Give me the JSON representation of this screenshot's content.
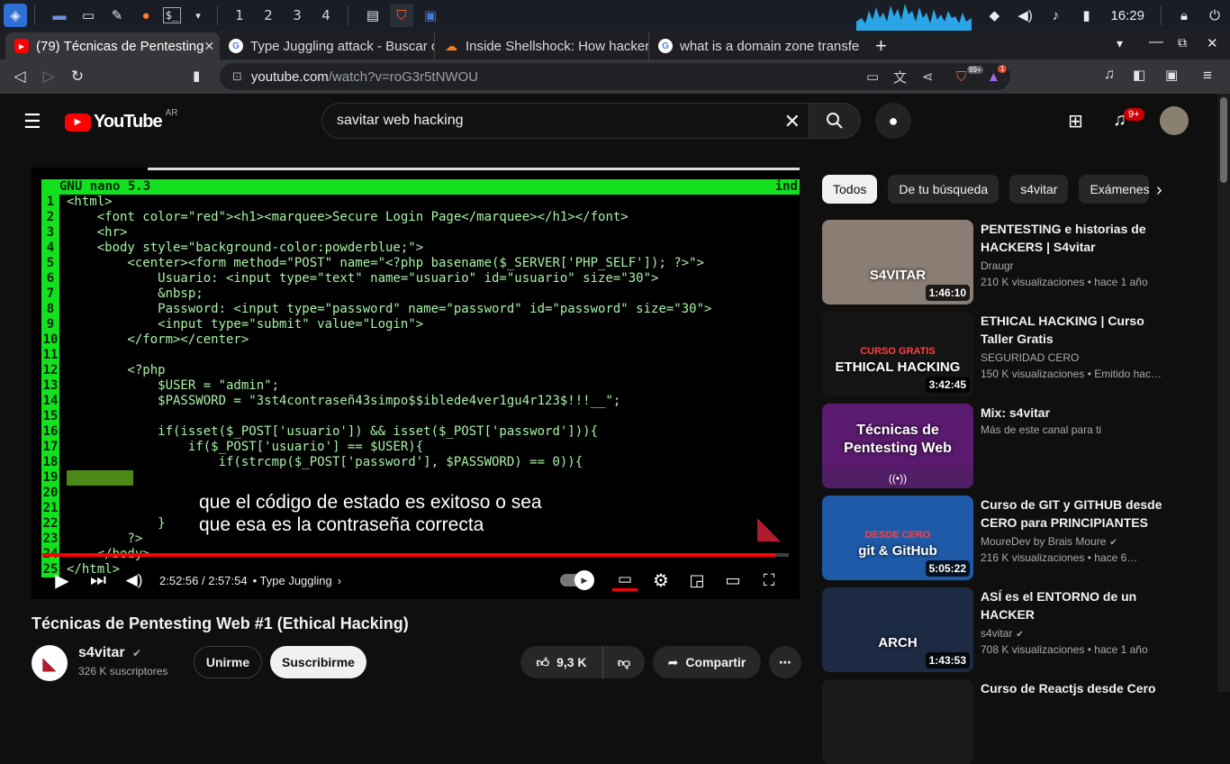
{
  "taskbar": {
    "workspaces": [
      "1",
      "2",
      "3",
      "4"
    ],
    "clock": "16:29"
  },
  "tabs": [
    {
      "title": "(79) Técnicas de Pentesting",
      "favicon": "youtube-icon"
    },
    {
      "title": "Type Juggling attack - Buscar c",
      "favicon": "google-icon"
    },
    {
      "title": "Inside Shellshock: How hacker",
      "favicon": "cloudflare-icon"
    },
    {
      "title": "what is a domain zone transfe",
      "favicon": "google-icon"
    }
  ],
  "address": {
    "host": "youtube.com",
    "path": "/watch?v=roG3r5tNWOU",
    "brave_count": "99+",
    "alert_count": "1"
  },
  "youtube": {
    "logo_text": "YouTube",
    "region": "AR",
    "search_value": "savitar web hacking",
    "notifications": "9+"
  },
  "video": {
    "nano_header": "GNU nano 5.3",
    "nano_header_right": "ind",
    "code_lines": [
      {
        "n": "1",
        "t": "<html>"
      },
      {
        "n": "2",
        "t": "    <font color=\"red\"><h1><marquee>Secure Login Page</marquee></h1></font>"
      },
      {
        "n": "3",
        "t": "    <hr>"
      },
      {
        "n": "4",
        "t": "    <body style=\"background-color:powderblue;\">"
      },
      {
        "n": "5",
        "t": "        <center><form method=\"POST\" name=\"<?php basename($_SERVER['PHP_SELF']); ?>\">"
      },
      {
        "n": "6",
        "t": "            Usuario: <input type=\"text\" name=\"usuario\" id=\"usuario\" size=\"30\">"
      },
      {
        "n": "7",
        "t": "            &nbsp;"
      },
      {
        "n": "8",
        "t": "            Password: <input type=\"password\" name=\"password\" id=\"password\" size=\"30\">"
      },
      {
        "n": "9",
        "t": "            <input type=\"submit\" value=\"Login\">"
      },
      {
        "n": "10",
        "t": "        </form></center>"
      },
      {
        "n": "11",
        "t": ""
      },
      {
        "n": "12",
        "t": "        <?php"
      },
      {
        "n": "13",
        "t": "            $USER = \"admin\";"
      },
      {
        "n": "14",
        "t": "            $PASSWORD = \"3st4contraseñ43simpo$$iblede4ver1gu4r123$!!!__\";"
      },
      {
        "n": "15",
        "t": ""
      },
      {
        "n": "16",
        "t": "            if(isset($_POST['usuario']) && isset($_POST['password'])){"
      },
      {
        "n": "17",
        "t": "                if($_POST['usuario'] == $USER){"
      },
      {
        "n": "18",
        "t": "                    if(strcmp($_POST['password'], $PASSWORD) == 0)){"
      },
      {
        "n": "19",
        "t": ""
      },
      {
        "n": "20",
        "t": ""
      },
      {
        "n": "21",
        "t": ""
      },
      {
        "n": "22",
        "t": "            }"
      },
      {
        "n": "23",
        "t": "        ?>"
      },
      {
        "n": "24",
        "t": "    </body>"
      },
      {
        "n": "25",
        "t": "</html>"
      }
    ],
    "subtitle_line1": "que el código de estado es exitoso o sea",
    "subtitle_line2": "que esa es la contraseña correcta",
    "progress": 0.982,
    "time": "2:52:56 / 2:57:54",
    "chapter": "• Type Juggling"
  },
  "info": {
    "title": "Técnicas de Pentesting Web #1 (Ethical Hacking)",
    "channel": "s4vitar",
    "subscribers": "326 K suscriptores",
    "join": "Unirme",
    "subscribe": "Suscribirme",
    "likes": "9,3 K",
    "share": "Compartir"
  },
  "chips": [
    "Todos",
    "De tu búsqueda",
    "s4vitar",
    "Exámenes"
  ],
  "recommendations": [
    {
      "title": "PENTESTING e historias de HACKERS | S4vitar",
      "channel": "Draugr",
      "meta": "210 K visualizaciones  •  hace 1 año",
      "duration": "1:46:10",
      "thumb_text": "S4VITAR",
      "thumb_color": "#8a7d74",
      "verified": false
    },
    {
      "title": "ETHICAL HACKING | Curso Taller Gratis",
      "channel": "SEGURIDAD CERO",
      "meta": "150 K visualizaciones  •  Emitido hac…",
      "duration": "3:42:45",
      "thumb_text": "ETHICAL HACKING",
      "thumb_sub": "CURSO GRATIS",
      "thumb_color": "#151515",
      "verified": false
    },
    {
      "title": "Mix: s4vitar",
      "channel": "Más de este canal para ti",
      "meta": "",
      "duration": "",
      "thumb_text": "Técnicas de Pentesting Web",
      "thumb_color": "#5a1a6e",
      "verified": false
    },
    {
      "title": "Curso de GIT y GITHUB desde CERO para PRINCIPIANTES",
      "channel": "MoureDev by Brais Moure",
      "meta": "216 K visualizaciones  •  hace 6…",
      "duration": "5:05:22",
      "thumb_text": "git & GitHub",
      "thumb_sub": "DESDE CERO",
      "thumb_color": "#1e5aa8",
      "verified": true
    },
    {
      "title": "ASÍ es el ENTORNO de un HACKER",
      "channel": "s4vitar",
      "meta": "708 K visualizaciones  •  hace 1 año",
      "duration": "1:43:53",
      "thumb_text": "ARCH",
      "thumb_color": "#1d2a44",
      "verified": true
    },
    {
      "title": "Curso de Reactjs desde Cero",
      "channel": "",
      "meta": "",
      "duration": "",
      "thumb_text": "",
      "thumb_color": "#1a1a1a",
      "verified": false
    }
  ]
}
